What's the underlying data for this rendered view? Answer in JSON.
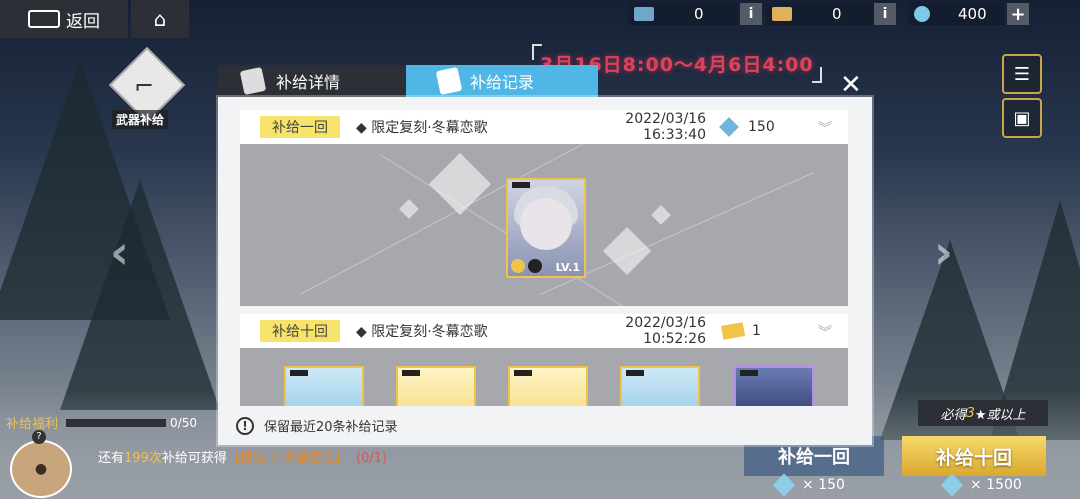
{
  "topbar": {
    "back_label": "返回",
    "currencies": [
      {
        "name": "ticket-blue",
        "value": "0",
        "color": "#6fa6c9"
      },
      {
        "name": "ticket-gold",
        "value": "0",
        "color": "#e0b05a"
      },
      {
        "name": "gem",
        "value": "400",
        "color": "#7ec8e8"
      }
    ],
    "info_label": "i",
    "plus_label": "+"
  },
  "banner": {
    "date_range": "3月16日8:00～4月6日4:00"
  },
  "weapon_badge": {
    "label": "武器补给"
  },
  "modal": {
    "tabs": [
      {
        "label": "补给详情",
        "active": false
      },
      {
        "label": "补给记录",
        "active": true
      }
    ],
    "close": "✕",
    "records": [
      {
        "type": "补给一回",
        "name": "◆ 限定复刻·冬幕恋歌",
        "date": "2022/03/16 16:33:40",
        "cost": "150",
        "cost_icon": "gem",
        "card_level": "LV.1"
      },
      {
        "type": "补给十回",
        "name": "◆ 限定复刻·冬幕恋歌",
        "date": "2022/03/16 10:52:26",
        "cost": "1",
        "cost_icon": "ticket"
      }
    ],
    "footer_note": "保留最近20条补给记录",
    "footer_icon": "!"
  },
  "bottom": {
    "progress_label": "补给福利",
    "progress_value": "0/50",
    "remain_prefix": "还有",
    "remain_num": "199次",
    "remain_mid": "补给可获得",
    "remain_item": "【模组书·冬幕恋歌】",
    "remain_count": "(0/1)",
    "guarantee_prefix": "必得",
    "guarantee_num": "3",
    "guarantee_suffix": "★或以上",
    "one_button": "补给一回",
    "ten_button": "补给十回",
    "one_cost": "× 150",
    "ten_cost": "× 1500"
  }
}
